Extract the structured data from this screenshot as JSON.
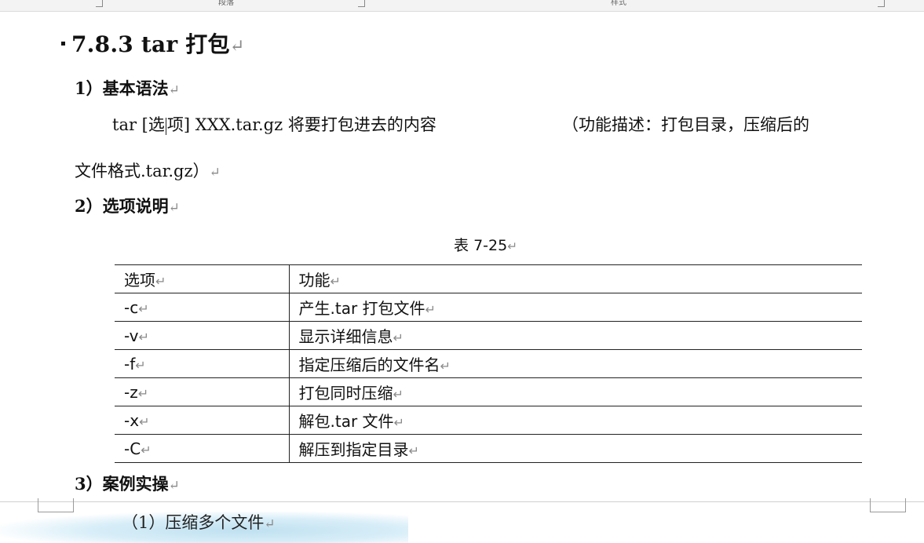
{
  "ribbon": {
    "groups": [
      "段落",
      "样式"
    ]
  },
  "heading": {
    "text": "7.8.3 tar 打包",
    "para_mark": "↵"
  },
  "section1": {
    "title": "1）基本语法",
    "syntax_prefix": "tar [选",
    "syntax_rest": "项] XXX.tar.gz 将要打包进去的内容",
    "desc_first": "（功能描述：打包目录，压缩后的",
    "desc_second": "文件格式.tar.gz）"
  },
  "section2": {
    "title": "2）选项说明"
  },
  "table": {
    "caption": "表 7-25",
    "header": {
      "option": "选项",
      "function": "功能"
    },
    "rows": [
      {
        "option": "-c",
        "function": "产生.tar 打包文件"
      },
      {
        "option": "-v",
        "function": "显示详细信息"
      },
      {
        "option": "-f",
        "function": "指定压缩后的文件名"
      },
      {
        "option": "-z",
        "function": "打包同时压缩"
      },
      {
        "option": "-x",
        "function": "解包.tar 文件"
      },
      {
        "option": "-C",
        "function": "解压到指定目录"
      }
    ]
  },
  "section3": {
    "title": "3）案例实操",
    "sub1": "（1）压缩多个文件"
  }
}
